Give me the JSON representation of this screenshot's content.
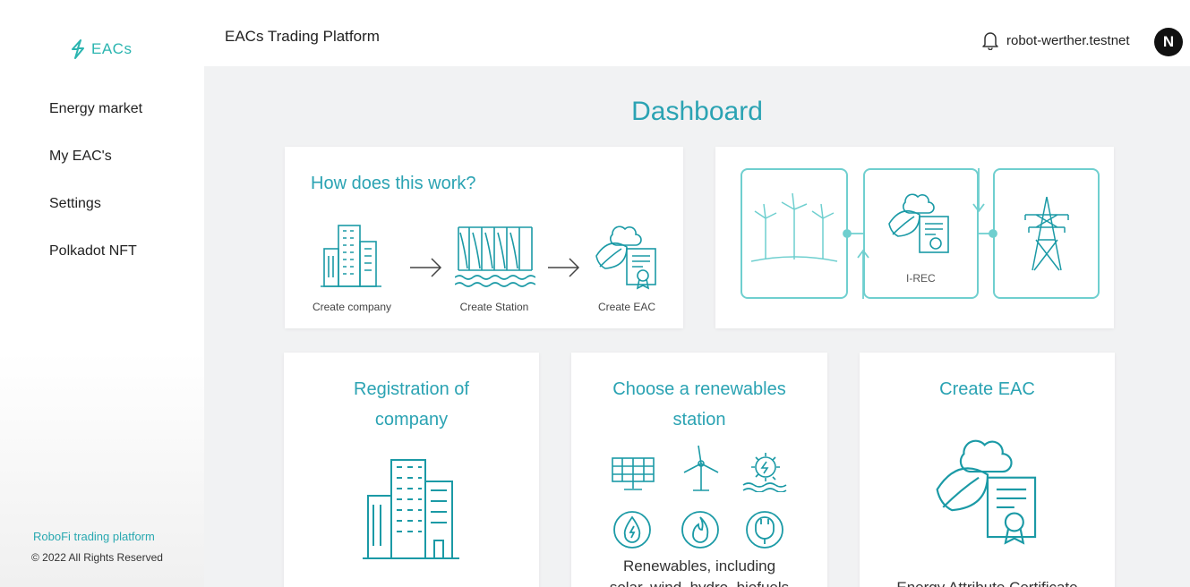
{
  "brand": {
    "name": "EACs",
    "accent": "#2bb5b0"
  },
  "sidebar": {
    "items": [
      {
        "label": "Energy market"
      },
      {
        "label": "My EAC's"
      },
      {
        "label": "Settings"
      },
      {
        "label": "Polkadot NFT"
      }
    ],
    "footer_link": "RoboFi trading platform",
    "copyright": "© 2022 All Rights Reserved"
  },
  "header": {
    "title": "EACs Trading Platform",
    "account": "robot-werther.testnet",
    "avatar_letter": "N",
    "icons": [
      "bell-icon",
      "near-logo"
    ]
  },
  "main": {
    "title": "Dashboard",
    "how": {
      "title": "How does this work?",
      "steps": [
        {
          "label": "Create company",
          "icon": "buildings-icon"
        },
        {
          "label": "Create Station",
          "icon": "dam-icon"
        },
        {
          "label": "Create EAC",
          "icon": "leaf-certificate-icon"
        }
      ]
    },
    "flow": {
      "label": "I-REC",
      "icons": [
        "wind-turbines-icon",
        "leaf-certificate-icon",
        "power-tower-icon"
      ]
    },
    "cards": [
      {
        "title": "Registration of company",
        "icon": "buildings-icon"
      },
      {
        "title": "Choose a renewables station",
        "desc_line1": "Renewables, including",
        "desc_line2": "solar, wind, hydro, biofuels",
        "icons": [
          "solar-panel-icon",
          "wind-turbine-icon",
          "sun-water-icon",
          "water-drop-icon",
          "flame-icon",
          "plug-icon"
        ]
      },
      {
        "title": "Create EAC",
        "desc": "Energy Attribute Certificate",
        "icon": "leaf-certificate-icon"
      }
    ],
    "colors": {
      "accent": "#2ba3b3",
      "icon": "#1b9aa6",
      "background": "#f1f2f3"
    }
  }
}
